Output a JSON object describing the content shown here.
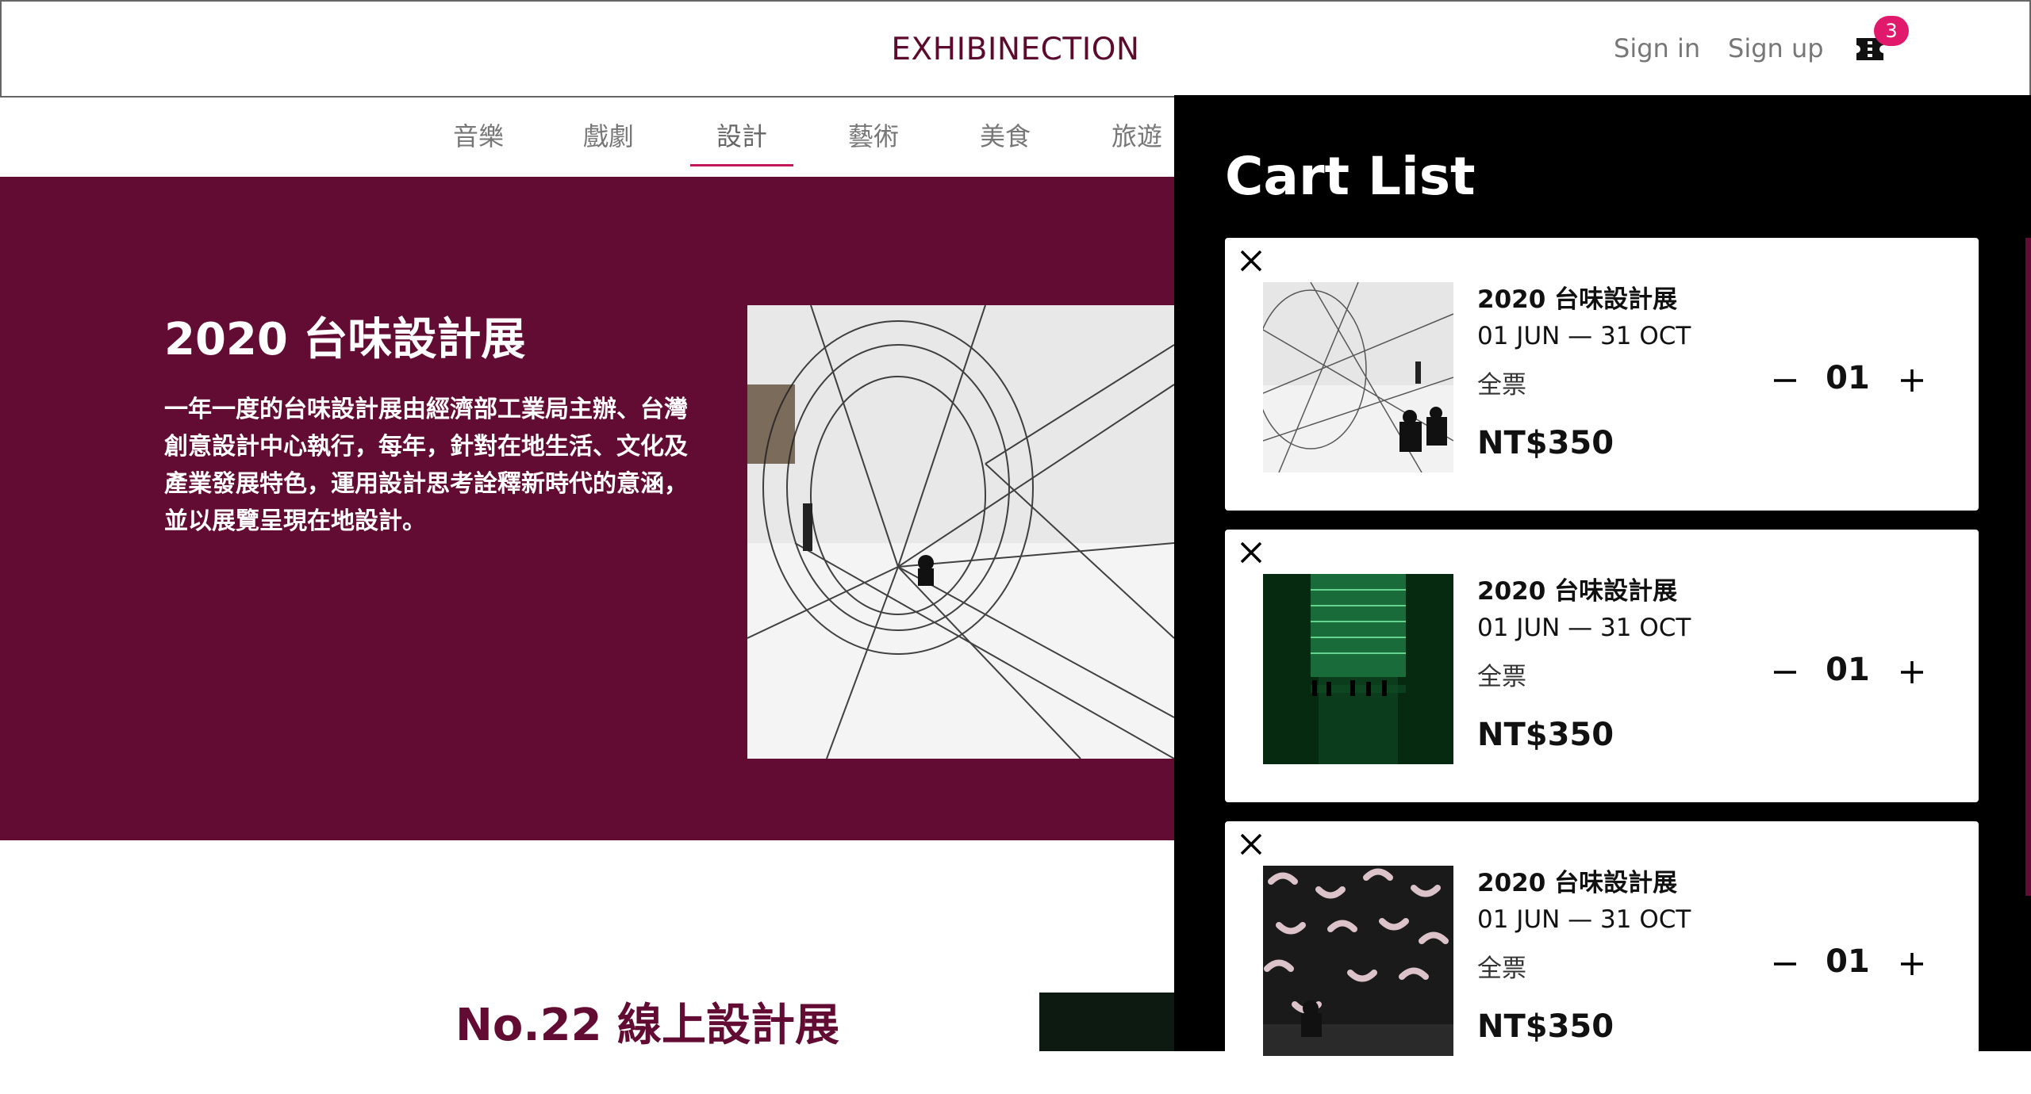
{
  "header": {
    "brand": "EXHIBINECTION",
    "sign_in": "Sign in",
    "sign_up": "Sign up",
    "cart_icon": "ticket-icon",
    "cart_count": "3",
    "badge_color": "#e0196d"
  },
  "nav": {
    "items": [
      {
        "label": "音樂"
      },
      {
        "label": "戲劇"
      },
      {
        "label": "設計"
      },
      {
        "label": "藝術"
      },
      {
        "label": "美食"
      },
      {
        "label": "旅遊"
      }
    ],
    "active": "設計"
  },
  "hero": {
    "title": "2020 台味設計展",
    "description": "一年一度的台味設計展由經濟部工業局主辦、台灣創意設計中心執行，每年，針對在地生活、文化及產業發展特色，運用設計思考詮釋新時代的意涵，並以展覽呈現在地設計。",
    "background": "#630c33"
  },
  "section": {
    "title": "No.22 線上設計展"
  },
  "cart": {
    "title": "Cart List",
    "items": [
      {
        "title": "2020 台味設計展",
        "date": "01 JUN — 31 OCT",
        "type": "全票",
        "price": "NT$350",
        "qty": "01",
        "thumb": "string-installation-image"
      },
      {
        "title": "2020 台味設計展",
        "date": "01 JUN — 31 OCT",
        "type": "全票",
        "price": "NT$350",
        "qty": "01",
        "thumb": "green-light-room-image"
      },
      {
        "title": "2020 台味設計展",
        "date": "01 JUN — 31 OCT",
        "type": "全票",
        "price": "NT$350",
        "qty": "01",
        "thumb": "projection-art-image"
      }
    ]
  }
}
